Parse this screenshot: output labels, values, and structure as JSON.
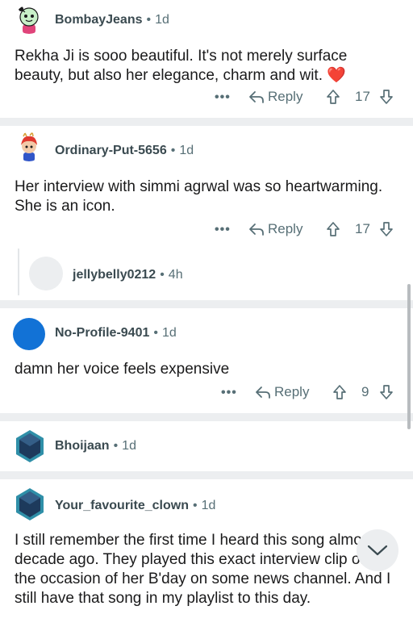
{
  "comments": [
    {
      "user": "BombayJeans",
      "age": "1d",
      "text": "Rekha Ji is sooo beautiful. It's not merely surface beauty, but also her elegance, charm and wit. ❤️",
      "reply_label": "Reply",
      "votes": "17"
    },
    {
      "user": "Ordinary-Put-5656",
      "age": "1d",
      "text": "Her interview with simmi agrwal was so heartwarming. She is an icon.",
      "reply_label": "Reply",
      "votes": "17"
    },
    {
      "user": "jellybelly0212",
      "age": "4h"
    },
    {
      "user": "No-Profile-9401",
      "age": "1d",
      "text": "damn her voice feels expensive",
      "reply_label": "Reply",
      "votes": "9"
    },
    {
      "user": "Bhoijaan",
      "age": "1d"
    },
    {
      "user": "Your_favourite_clown",
      "age": "1d",
      "text": "I still remember the first time I heard this song almost a decade ago. They played this exact interview clip of her the occasion of her B'day on some news channel. And I still have that song in my playlist to this day."
    }
  ],
  "ui": {
    "more_glyph": "•••",
    "separator": "•",
    "heart": "❤️"
  },
  "colors": {
    "meta": "#576f76",
    "separator": "#eceef0",
    "thread_line": "#e3e6e8",
    "avatar_blue": "#1272d6"
  }
}
